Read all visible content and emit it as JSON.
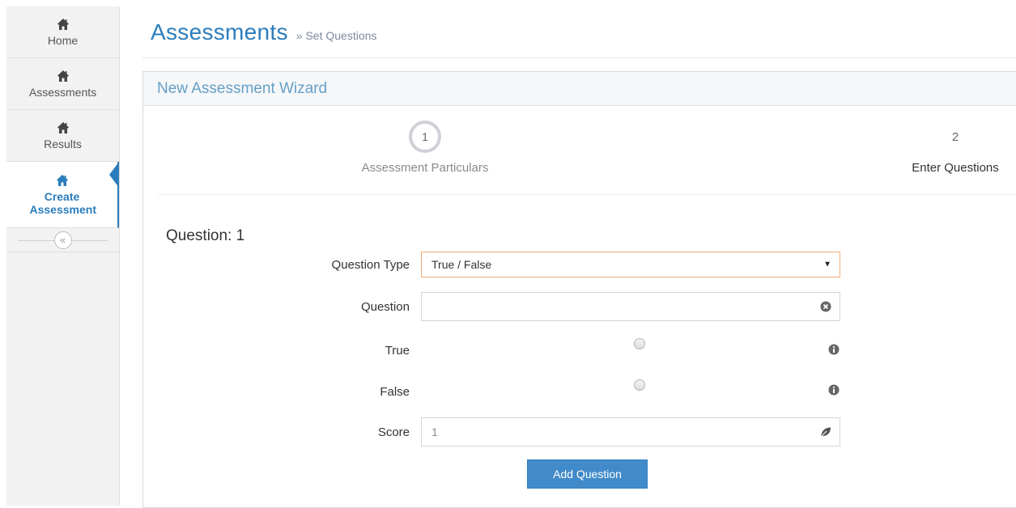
{
  "sidebar": {
    "items": [
      {
        "label": "Home",
        "icon": "home-icon"
      },
      {
        "label": "Assessments",
        "icon": "home-icon"
      },
      {
        "label": "Results",
        "icon": "home-icon"
      },
      {
        "label": "Create Assessment",
        "icon": "home-icon",
        "active": true
      }
    ],
    "collapse_icon": "double-chevron-left-icon",
    "collapse_glyph": "«"
  },
  "header": {
    "title": "Assessments",
    "breadcrumb": "» Set Questions"
  },
  "wizard": {
    "title": "New Assessment Wizard",
    "steps": [
      {
        "number": "1",
        "label": "Assessment Particulars"
      },
      {
        "number": "2",
        "label": "Enter Questions"
      }
    ]
  },
  "form": {
    "question_title": "Question: 1",
    "question_type": {
      "label": "Question Type",
      "value": "True / False"
    },
    "question": {
      "label": "Question",
      "value": ""
    },
    "true_option": {
      "label": "True"
    },
    "false_option": {
      "label": "False"
    },
    "score": {
      "label": "Score",
      "value": "1"
    },
    "submit_label": "Add Question"
  },
  "colors": {
    "accent": "#2b7dbc",
    "button": "#428bca",
    "select_border": "#f0ad7a"
  }
}
